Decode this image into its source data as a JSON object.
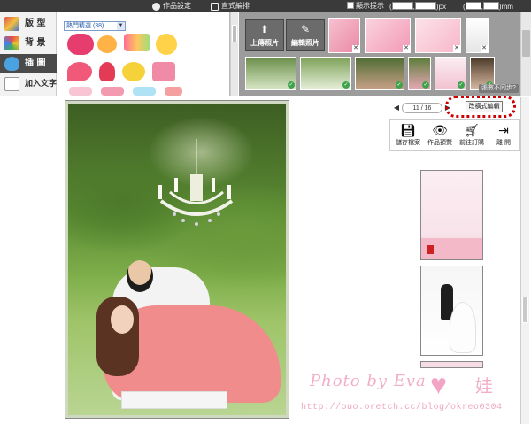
{
  "topbar": {
    "tabs": [
      {
        "label": "作品設定",
        "icon": "gear-icon"
      },
      {
        "label": "直式編排",
        "icon": "page-icon"
      }
    ],
    "hint_label": "顯示提示",
    "dims": {
      "open_paren": "(",
      "unit1": ")px",
      "unit2": ")mm"
    }
  },
  "leftmenu": {
    "items": [
      {
        "label": "版 型",
        "icon": "layout-icon",
        "active": false
      },
      {
        "label": "背 景",
        "icon": "background-icon",
        "active": false
      },
      {
        "label": "插 圖",
        "icon": "sticker-icon",
        "active": true
      },
      {
        "label": "加入文字",
        "icon": "text-icon",
        "active": false
      }
    ]
  },
  "stickers": {
    "category": "熱門精選 (38)"
  },
  "photos": {
    "upload_label": "上傳照片",
    "edit_label": "編輯照片",
    "size_hint": "張數不同步?"
  },
  "pager": {
    "value": "11 / 16",
    "prev": "◀",
    "next": "▶",
    "mode_button": "改橫式編輯"
  },
  "toolbar": {
    "save": "儲存檔案",
    "preview": "作品預覽",
    "order": "前往訂購",
    "leave": "離 開"
  },
  "watermark": {
    "text": "Photo by Eva",
    "sig": "娃",
    "url": "http://ouo.oretch.cc/blog/okreo0304"
  },
  "colors": {
    "dark_bar": "#3a3a3a",
    "photo_panel": "#9c9c9c",
    "highlight": "#cc0000",
    "watermark": "#f0a0be"
  }
}
